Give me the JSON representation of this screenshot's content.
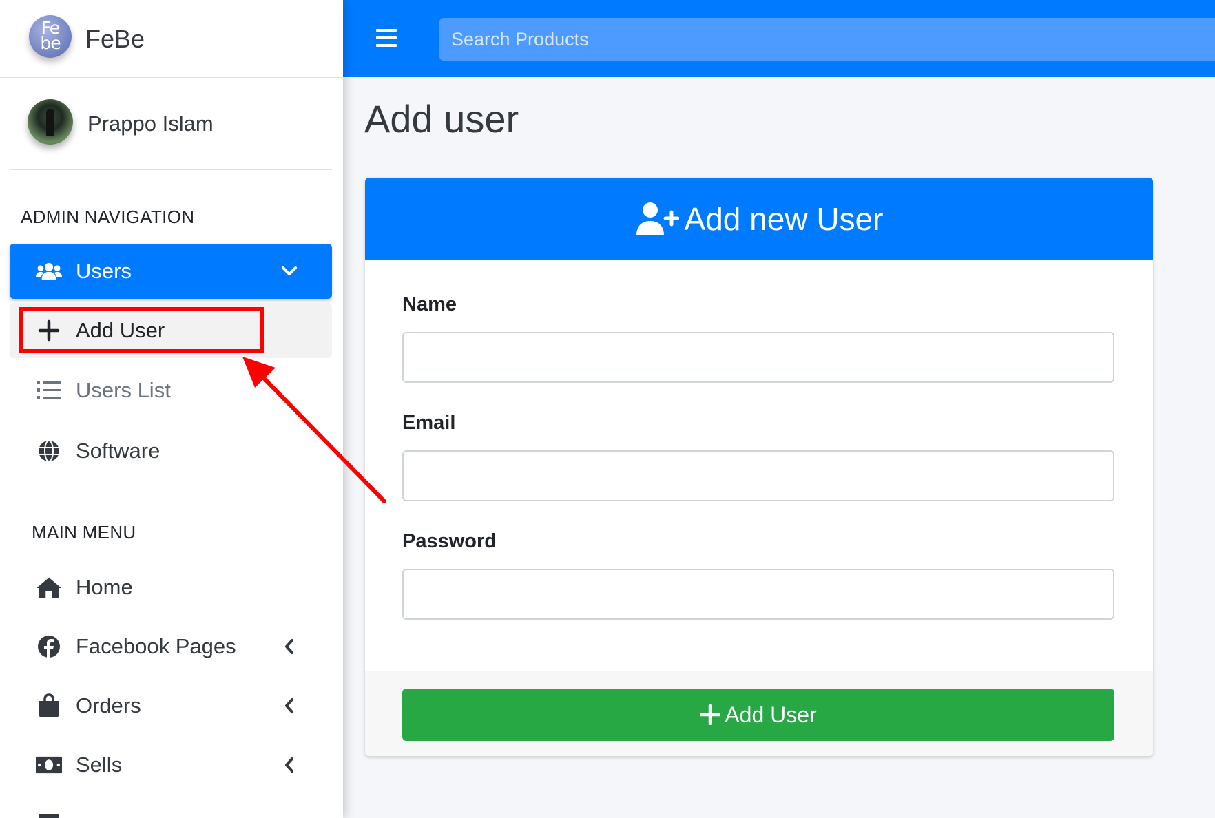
{
  "brand": {
    "logo_text_top": "Fe",
    "logo_text_bottom": "be",
    "name": "FeBe"
  },
  "user": {
    "name": "Prappo Islam"
  },
  "topbar": {
    "search_placeholder": "Search Products"
  },
  "sidebar": {
    "admin_header": "ADMIN NAVIGATION",
    "admin_items": [
      {
        "label": "Users",
        "icon": "users-icon",
        "active": true,
        "expanded": true
      },
      {
        "label": "Add User",
        "icon": "plus-icon",
        "active": true
      },
      {
        "label": "Users List",
        "icon": "list-icon"
      },
      {
        "label": "Software",
        "icon": "globe-icon"
      }
    ],
    "main_header": "MAIN MENU",
    "main_items": [
      {
        "label": "Home",
        "icon": "home-icon"
      },
      {
        "label": "Facebook Pages",
        "icon": "facebook-icon"
      },
      {
        "label": "Orders",
        "icon": "shopping-bag-icon"
      },
      {
        "label": "Sells",
        "icon": "money-bill-icon"
      }
    ]
  },
  "page": {
    "title": "Add user"
  },
  "form": {
    "header": "Add new User",
    "name_label": "Name",
    "name_value": "",
    "email_label": "Email",
    "email_value": "",
    "password_label": "Password",
    "password_value": "",
    "submit_label": "Add User"
  },
  "annotation": {
    "highlight_color": "#ff0000",
    "arrow_color": "#ff0000"
  },
  "colors": {
    "primary": "#007bff",
    "success": "#28a745",
    "search_bg": "#4d9bff"
  }
}
